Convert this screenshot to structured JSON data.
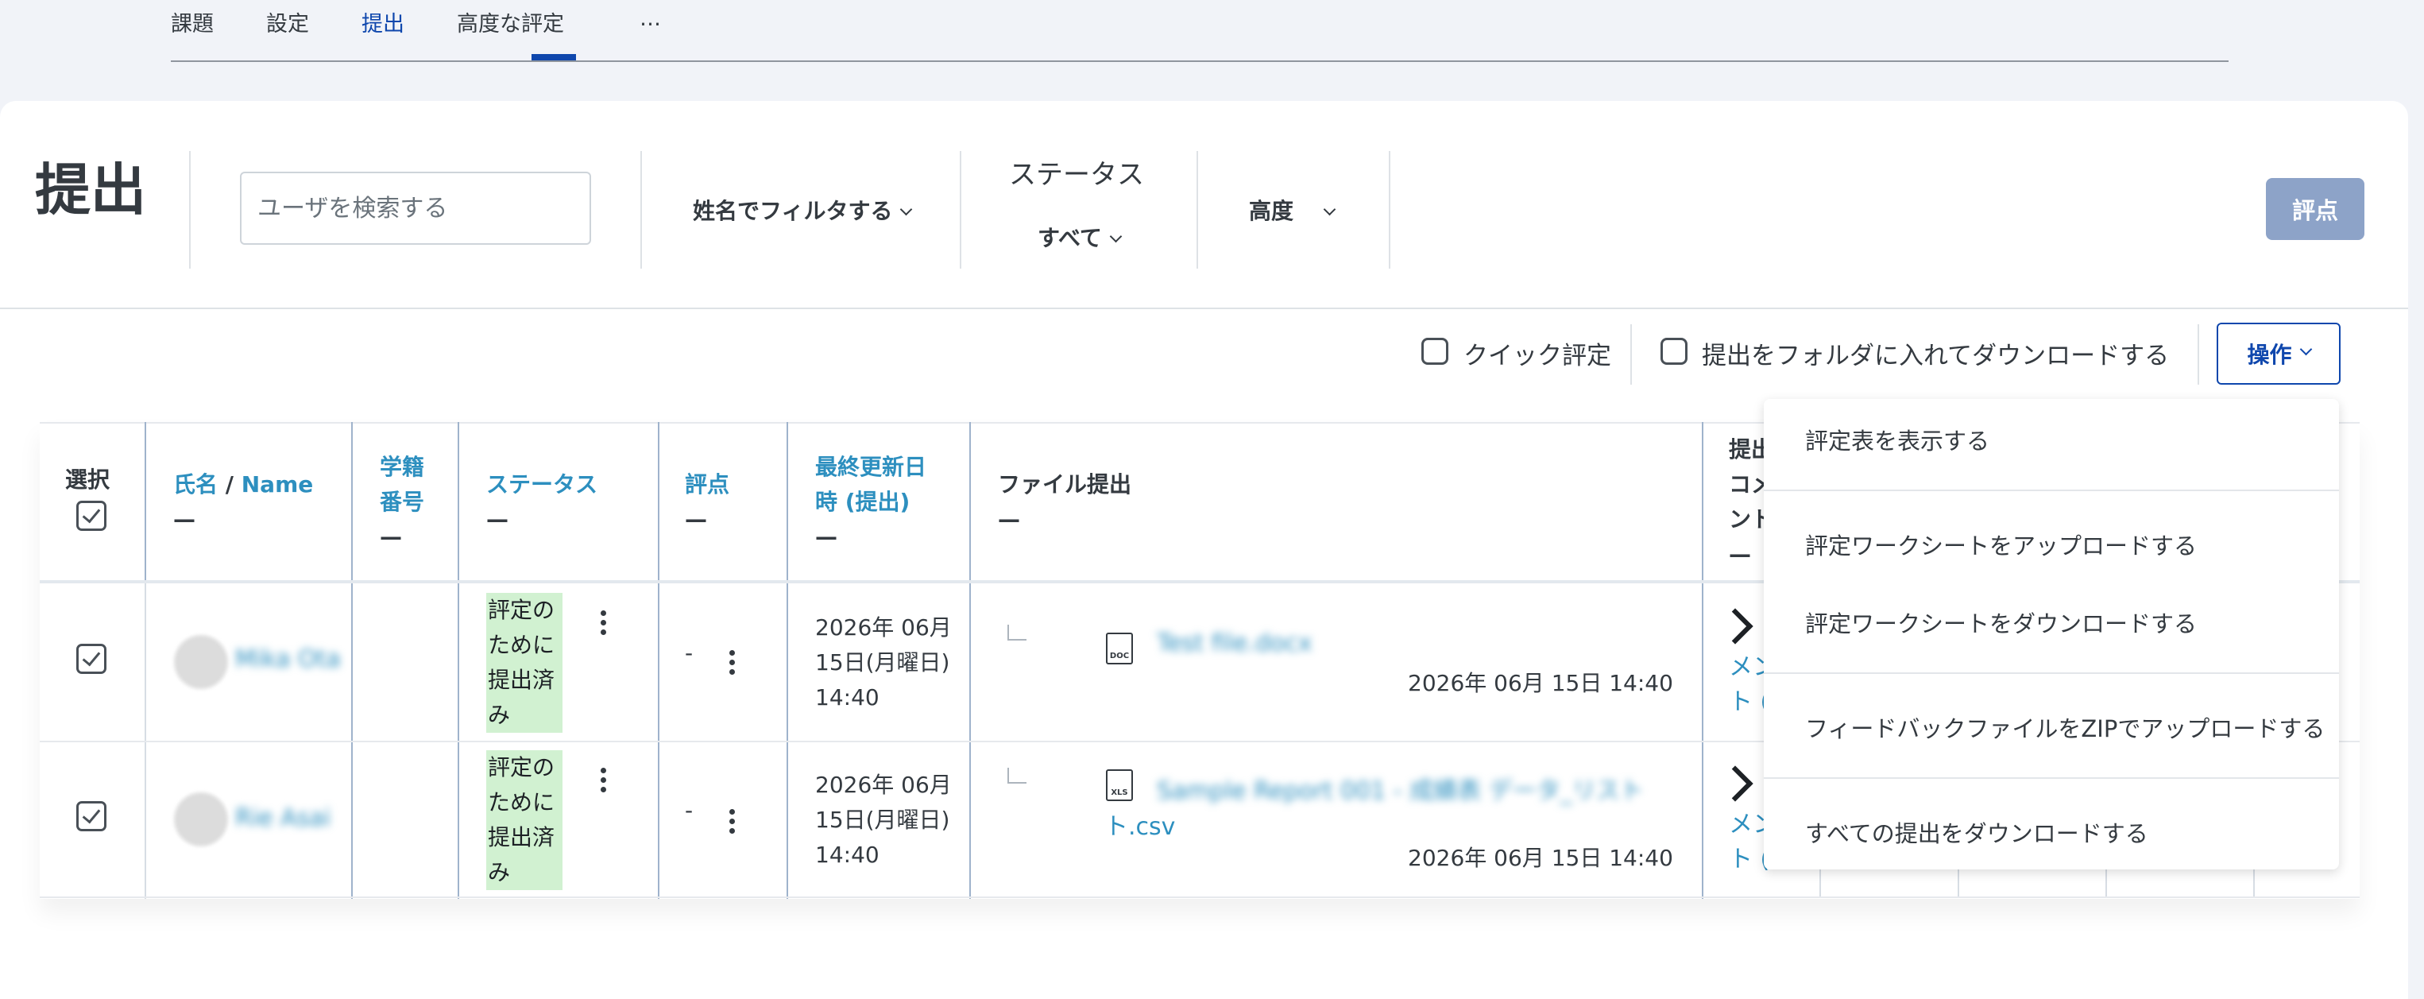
{
  "tabs": [
    {
      "label": "課題"
    },
    {
      "label": "設定"
    },
    {
      "label": "提出",
      "active": true
    },
    {
      "label": "高度な評定"
    },
    {
      "label": "…"
    }
  ],
  "page_title": "提出",
  "search": {
    "placeholder": "ユーザを検索する"
  },
  "filters": {
    "name_filter": "姓名でフィルタする",
    "status_label": "ステータス",
    "status_value": "すべて",
    "advanced": "高度"
  },
  "grade_button": "評点",
  "options": {
    "quick_grading": "クイック評定",
    "download_folders": "提出をフォルダに入れてダウンロードする",
    "actions": "操作"
  },
  "table": {
    "headers": {
      "select": "選択",
      "name_a": "氏名",
      "name_sep": " / ",
      "name_b": "Name",
      "idnumber_1": "学籍",
      "idnumber_2": "番号",
      "status": "ステータス",
      "grade": "評点",
      "modified_1": "最終更新日",
      "modified_2": "時 (提出)",
      "files": "ファイル提出",
      "comments_1": "提出",
      "comments_2": "コメ",
      "comments_3": "ント",
      "dash": "—"
    },
    "rows": [
      {
        "name": "Mika Ota",
        "status": [
          "評定の",
          "ために",
          "提出済",
          "み"
        ],
        "grade": "-",
        "modified": [
          "2026年 06月",
          "15日(月曜日)",
          "14:40"
        ],
        "file_type": "DOC",
        "file_name": "Test file.docx",
        "file_name_extra": "",
        "file_time": "2026年 06月 15日 14:40",
        "comment_link": [
          "メン",
          "ト ("
        ]
      },
      {
        "name": "Rie Asai",
        "status": [
          "評定の",
          "ために",
          "提出済",
          "み"
        ],
        "grade": "-",
        "modified": [
          "2026年 06月",
          "15日(月曜日)",
          "14:40"
        ],
        "file_type": "XLS",
        "file_name": "Sample Report 001 - 成績表 データ_リスト",
        "file_name_extra": "ト.csv",
        "file_time": "2026年 06月 15日 14:40",
        "comment_link": [
          "メン",
          "ト ("
        ]
      }
    ]
  },
  "actions_menu": [
    "評定表を表示する",
    "評定ワークシートをアップロードする",
    "評定ワークシートをダウンロードする",
    "フィードバックファイルをZIPでアップロードする",
    "すべての提出をダウンロードする"
  ]
}
